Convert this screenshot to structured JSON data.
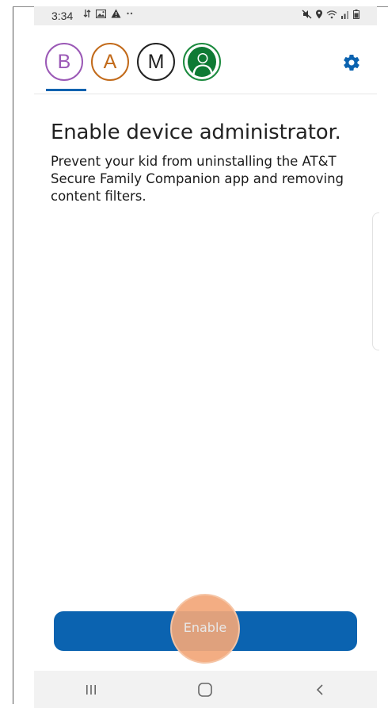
{
  "status_bar": {
    "time": "3:34",
    "left_icons": [
      "data-sync-icon",
      "image-icon",
      "warning-icon",
      "more-dots-icon"
    ],
    "right_icons": [
      "mute-icon",
      "location-icon",
      "wifi-icon",
      "signal-icon",
      "battery-icon"
    ]
  },
  "profiles": [
    {
      "initial": "B",
      "color": "#9b59b6",
      "selected": true
    },
    {
      "initial": "A",
      "color": "#c26a1a",
      "selected": false
    },
    {
      "initial": "M",
      "color": "#222222",
      "selected": false
    },
    {
      "initial": "",
      "icon": "person-icon",
      "color": "#0e7a34",
      "selected": false
    }
  ],
  "header": {
    "settings_icon": "gear-icon",
    "accent_color": "#0b63b0"
  },
  "content": {
    "title": "Enable device administrator.",
    "description": "Prevent your kid from uninstalling the AT&T Secure Family Companion app and removing content filters."
  },
  "actions": {
    "enable_label": "Enable",
    "button_color": "#0b63b0"
  },
  "nav_bar": {
    "items": [
      "recent-apps-icon",
      "home-icon",
      "back-icon"
    ]
  }
}
